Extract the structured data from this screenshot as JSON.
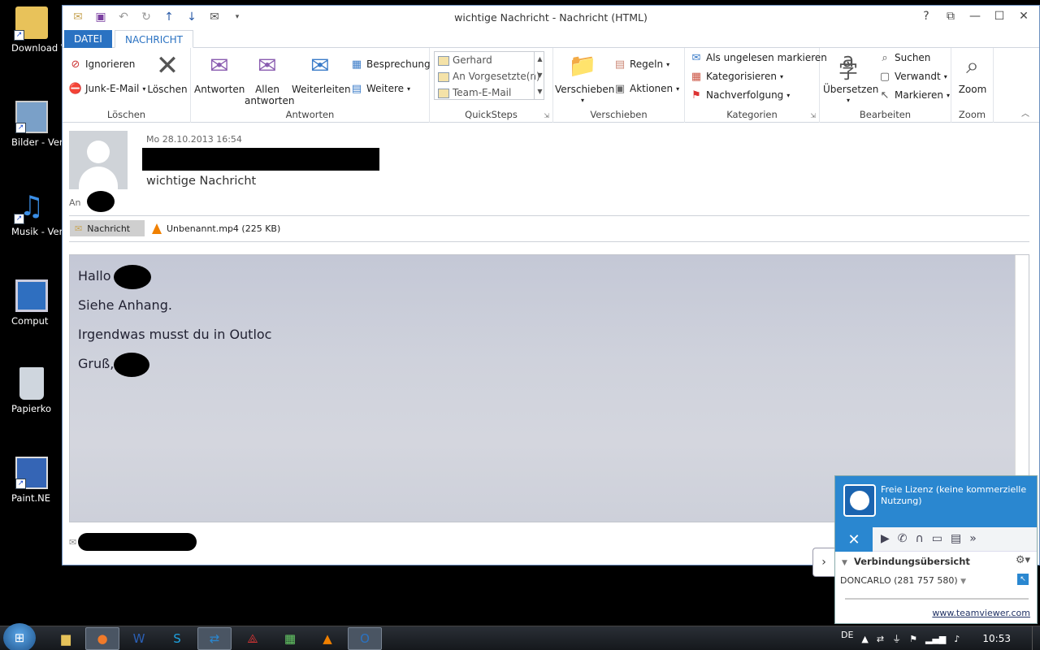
{
  "desktop": {
    "icons": [
      {
        "label": "Download Verknüpfu",
        "icon": "downloads-folder-icon"
      },
      {
        "label": "Bilder - Verkn",
        "icon": "pictures-icon"
      },
      {
        "label": "Musik - Verkn",
        "icon": "music-icon"
      },
      {
        "label": "Comput",
        "icon": "computer-icon"
      },
      {
        "label": "Papierko",
        "icon": "recycle-bin-icon"
      },
      {
        "label": "Paint.NE",
        "icon": "paintnet-icon"
      }
    ]
  },
  "window": {
    "title": "wichtige Nachricht  - Nachricht (HTML)",
    "help": "?",
    "tabs": {
      "file": "DATEI",
      "message": "NACHRICHT"
    }
  },
  "ribbon": {
    "groups": {
      "loeschen": "Löschen",
      "antworten": "Antworten",
      "quicksteps": "QuickSteps",
      "verschieben": "Verschieben",
      "kategorien": "Kategorien",
      "bearbeiten": "Bearbeiten",
      "zoom": "Zoom"
    },
    "ignorieren": "Ignorieren",
    "junk": "Junk-E-Mail",
    "loeschen_btn": "Löschen",
    "antworten_btn": "Antworten",
    "allen_1": "Allen",
    "allen_2": "antworten",
    "weiterleiten": "Weiterleiten",
    "besprechung": "Besprechung",
    "weitere": "Weitere",
    "quicksteps": [
      "Gerhard",
      "An Vorgesetzte(n)",
      "Team-E-Mail"
    ],
    "verschieben_btn": "Verschieben",
    "regeln": "Regeln",
    "aktionen": "Aktionen",
    "ungelesen": "Als ungelesen markieren",
    "kategorisieren": "Kategorisieren",
    "nachverfolgung": "Nachverfolgung",
    "uebersetzen": "Übersetzen",
    "suchen": "Suchen",
    "verwandt": "Verwandt",
    "markieren": "Markieren",
    "zoom_btn": "Zoom"
  },
  "message": {
    "date": "Mo 28.10.2013 16:54",
    "subject": "wichtige Nachricht",
    "to_label": "An",
    "tab_message": "Nachricht",
    "attachment": "Unbenannt.mp4 (225 KB)",
    "lines": [
      "Hallo",
      "Siehe Anhang.",
      "Irgendwas musst du in Outloc",
      "Gruß,"
    ]
  },
  "teamviewer": {
    "license": "Freie Lizenz (keine kommerzielle Nutzung)",
    "section": "Verbindungsübersicht",
    "partner": "DONCARLO (281 757 580)",
    "link": "www.teamviewer.com"
  },
  "taskbar": {
    "lang": "DE",
    "time": "10:53"
  }
}
